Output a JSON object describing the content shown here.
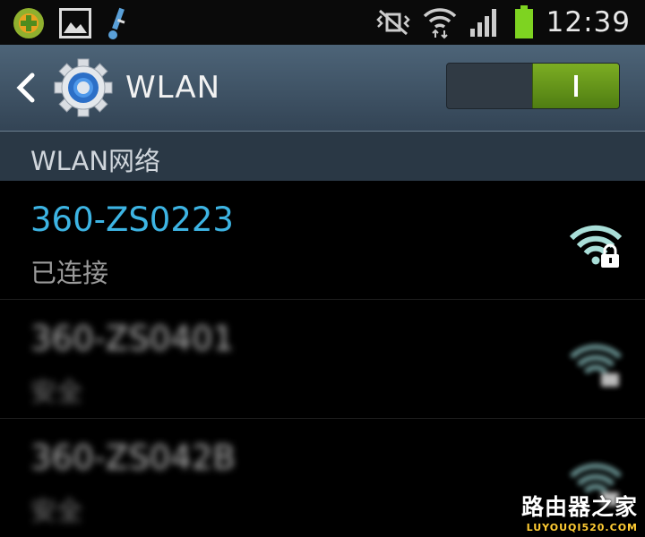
{
  "status_bar": {
    "time": "12:39",
    "icons": [
      "app-icon",
      "gallery-icon",
      "usb-icon",
      "vibrate-mute-icon",
      "wifi-status-icon",
      "cell-signal-icon",
      "battery-icon"
    ],
    "battery_color": "#7ed321"
  },
  "action_bar": {
    "title": "WLAN",
    "toggle_on": true,
    "toggle_color": "#6a9c1a"
  },
  "section": {
    "label": "WLAN网络"
  },
  "networks": [
    {
      "ssid": "360-ZS0223",
      "status": "已连接",
      "secured": true,
      "connected": true,
      "color": "#3db4e3"
    },
    {
      "ssid": "360-ZS0401",
      "status": "安全",
      "secured": true,
      "connected": false
    },
    {
      "ssid": "360-ZS042B",
      "status": "安全",
      "secured": true,
      "connected": false
    }
  ],
  "watermark": {
    "main": "路由器之家",
    "sub": "LUYOUQI520.COM"
  }
}
